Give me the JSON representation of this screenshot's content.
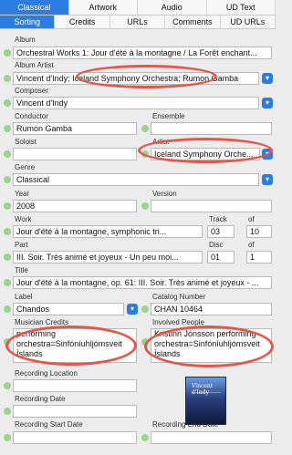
{
  "tabs_row1": [
    "Classical",
    "Artwork",
    "Audio",
    "UD Text"
  ],
  "tabs_row2": [
    "Sorting",
    "Credits",
    "URLs",
    "Comments",
    "UD URLs"
  ],
  "fields": {
    "album_label": "Album",
    "album_value": "Orchestral Works 1: Jour d'été à la montagne / La Forêt enchant...",
    "album_artist_label": "Album Artist",
    "album_artist_value": "Vincent d'Indy; Iceland Symphony Orchestra; Rumon Gamba",
    "composer_label": "Composer",
    "composer_value": "Vincent d'Indy",
    "conductor_label": "Conductor",
    "conductor_value": "Rumon Gamba",
    "ensemble_label": "Ensemble",
    "ensemble_value": "",
    "soloist_label": "Soloist",
    "soloist_value": "",
    "artist_label": "Artist",
    "artist_value": "Iceland Symphony Orche...",
    "genre_label": "Genre",
    "genre_value": "Classical",
    "year_label": "Year",
    "year_value": "2008",
    "version_label": "Version",
    "version_value": "",
    "work_label": "Work",
    "work_value": "Jour d'été à la montagne, symphonic tri...",
    "track_label": "Track",
    "track_value": "03",
    "track_of_label": "of",
    "track_of_value": "10",
    "part_label": "Part",
    "part_value": "III. Soir. Très animé et joyeux - Un peu moi...",
    "disc_label": "Disc",
    "disc_value": "01",
    "disc_of_label": "of",
    "disc_of_value": "1",
    "title_label": "Title",
    "title_value": "Jour d'été à la montagne, op. 61: III. Soir. Très animé et joyeux - ...",
    "label_label": "Label",
    "label_value": "Chandos",
    "catalog_label": "Catalog Number",
    "catalog_value": "CHAN 10464",
    "musician_credits_label": "Musician Credits",
    "musician_credits_value": "performing orchestra=Sinfóníuhljómsveit Íslands",
    "involved_people_label": "Involved People",
    "involved_people_value": "Kristinn Jónsson performing orchestra=Sinfóníuhljómsveit Íslands",
    "recording_location_label": "Recording Location",
    "recording_date_label": "Recording Date",
    "recording_start_label": "Recording Start Date",
    "recording_end_label": "Recording End Date"
  },
  "cover_text": "Vincent d'Indy",
  "icons": {
    "dropdown": "chevron-down-icon",
    "status": "status-dot-icon"
  },
  "colors": {
    "accent": "#2b7de1",
    "status_green": "#9bd38f",
    "highlight": "#e2584b"
  }
}
